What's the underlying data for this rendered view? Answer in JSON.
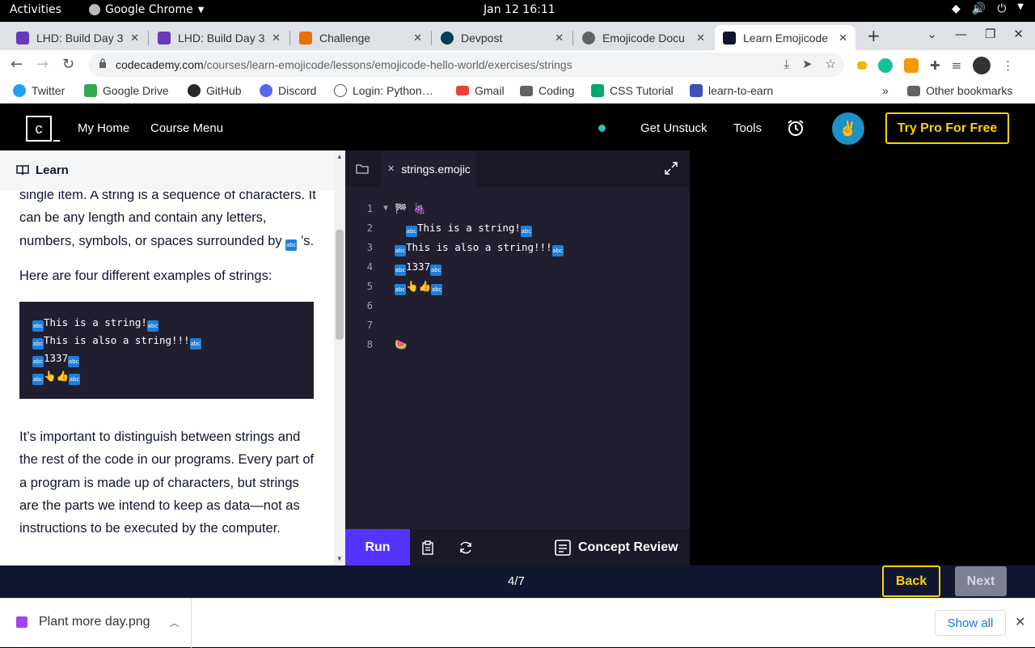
{
  "system": {
    "activities": "Activities",
    "app_name": "Google Chrome",
    "clock": "Jan 12  16:11"
  },
  "tabs": [
    {
      "title": "LHD: Build Day 3",
      "favicon_color": "#673ab7"
    },
    {
      "title": "LHD: Build Day 3",
      "favicon_color": "#673ab7"
    },
    {
      "title": "Challenge",
      "favicon_color": "#e8710a"
    },
    {
      "title": "Devpost",
      "favicon_color": "#003e54"
    },
    {
      "title": "Emojicode Docu",
      "favicon_color": "#5f6368"
    },
    {
      "title": "Learn Emojicode",
      "favicon_color": "#10162f"
    }
  ],
  "address": {
    "domain": "codecademy.com",
    "path": "/courses/learn-emojicode/lessons/emojicode-hello-world/exercises/strings"
  },
  "bookmarks": [
    {
      "label": "Twitter",
      "color": "#1da1f2"
    },
    {
      "label": "Google Drive",
      "color": "#34a853"
    },
    {
      "label": "GitHub",
      "color": "#24292e"
    },
    {
      "label": "Discord",
      "color": "#5865f2"
    },
    {
      "label": "Login: Python…",
      "color": "#555555"
    },
    {
      "label": "Gmail",
      "color": "#ea4335"
    },
    {
      "label": "Coding",
      "color": "#5f6368"
    },
    {
      "label": "CSS Tutorial",
      "color": "#04aa6d"
    },
    {
      "label": "learn-to-earn",
      "color": "#3f51b5"
    }
  ],
  "bookmarks_more": "»",
  "other_bookmarks": "Other bookmarks",
  "header": {
    "logo": "c",
    "my_home": "My Home",
    "course_menu": "Course Menu",
    "get_unstuck": "Get Unstuck",
    "tools": "Tools",
    "try_pro": "Try Pro For Free"
  },
  "learn": {
    "title": "Learn",
    "para1_a": "single item. A string is a sequence of characters. It can be any length and contain any letters, numbers, symbols, or spaces surrounded by ",
    "para1_b": " ’s.",
    "para2": "Here are four different examples of strings:",
    "para3": "It’s important to distinguish between strings and the rest of the code in our programs. Every part of a program is made up of characters, but strings are the parts we intend to keep as data—not as instructions to be executed by the computer.",
    "code_lines": [
      {
        "text": "This is a string!"
      },
      {
        "text": "This is also a string!!!"
      },
      {
        "text": "1337"
      },
      {
        "text": "👆👍"
      }
    ],
    "abc_glyph": "abc"
  },
  "editor": {
    "filename": "strings.emojic",
    "line_numbers": [
      "1",
      "2",
      "3",
      "4",
      "5",
      "6",
      "7",
      "8"
    ],
    "line1": "🏁 🍇",
    "line2": "This is a string!",
    "line3": "This is also a string!!!",
    "line4": "1337",
    "line5": "👆👍",
    "line8": "🍉",
    "run": "Run",
    "concept_review": "Concept Review"
  },
  "bottom": {
    "progress": "4/7",
    "back": "Back",
    "next": "Next"
  },
  "downloads": {
    "file": "Plant more day.png",
    "show_all": "Show all"
  }
}
